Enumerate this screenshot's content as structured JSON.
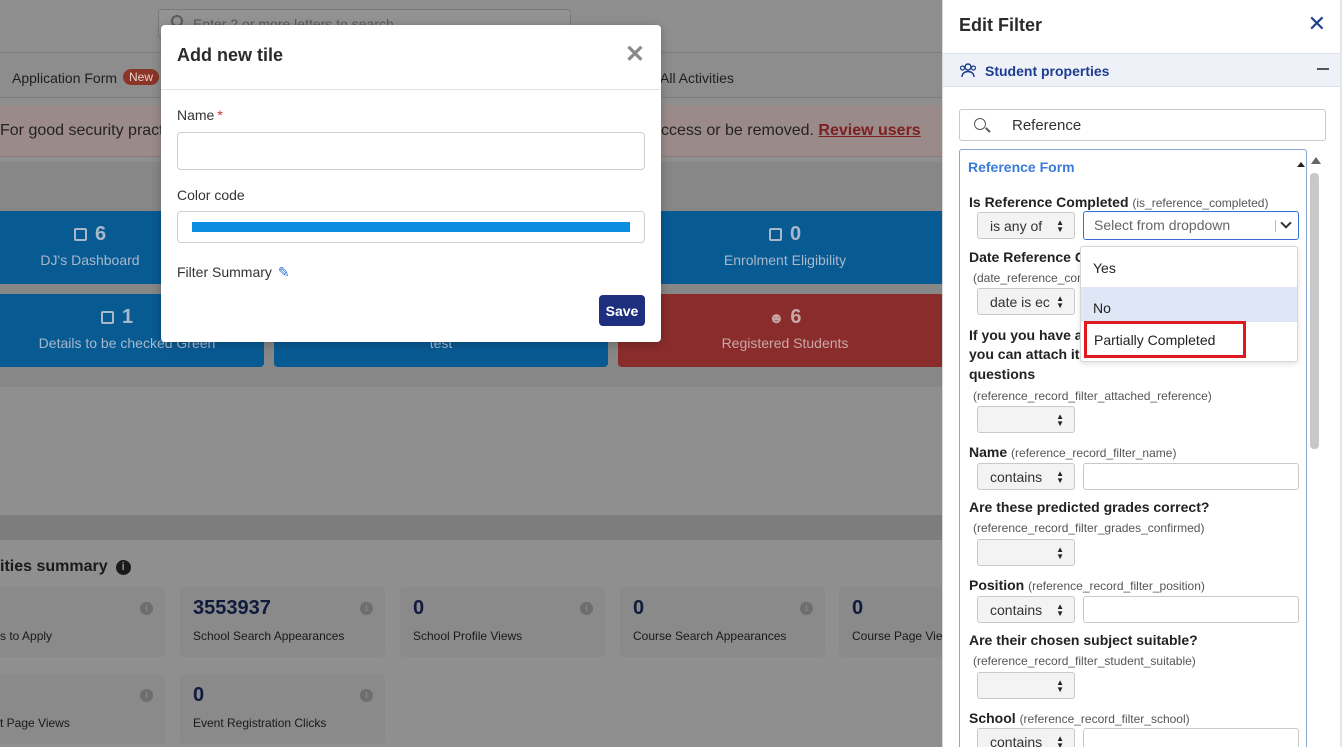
{
  "background": {
    "search_placeholder": "Enter 2 or more letters to search",
    "nav": {
      "application_form": "Application Form",
      "new_badge": "New",
      "all_activities": "All Activities"
    },
    "alert": {
      "text_left": "For good security practic",
      "text_right": "ccess or be removed.",
      "link": "Review users"
    },
    "tiles": [
      {
        "count": "6",
        "label": "DJ's Dashboard"
      },
      {
        "count": "0",
        "label": "Enrolment Eligibility"
      },
      {
        "count": "1",
        "label": "Details to be checked Green"
      },
      {
        "count": "",
        "label": "test"
      },
      {
        "count": "6",
        "label": "Registered Students"
      }
    ],
    "summary": {
      "title": "ities summary",
      "cards": [
        {
          "value": "",
          "label": "s to Apply"
        },
        {
          "value": "3553937",
          "label": "School Search Appearances"
        },
        {
          "value": "0",
          "label": "School Profile Views"
        },
        {
          "value": "0",
          "label": "Course Search Appearances"
        },
        {
          "value": "0",
          "label": "Course Page Vie"
        },
        {
          "value": "",
          "label": "t Page Views"
        },
        {
          "value": "0",
          "label": "Event Registration Clicks"
        }
      ]
    }
  },
  "modal": {
    "title": "Add new tile",
    "name_label": "Name",
    "required_mark": "*",
    "color_label": "Color code",
    "color_value": "#0a8de0",
    "filter_summary_label": "Filter Summary",
    "save_label": "Save"
  },
  "panel": {
    "title": "Edit Filter",
    "section_title": "Student properties",
    "search_value": "Reference",
    "form_title": "Reference Form",
    "questions": {
      "q1": {
        "label": "Is Reference Completed",
        "code": "(is_reference_completed)",
        "operator": "is any of",
        "dropdown_placeholder": "Select from dropdown"
      },
      "q2": {
        "label": "Date Reference C",
        "code": "(date_reference_com",
        "operator": "date is ec"
      },
      "q3": {
        "label_line1": "If you you have a",
        "label_line2": "you can attach it",
        "label_line3": "questions",
        "code": "(reference_record_filter_attached_reference)"
      },
      "q4": {
        "label": "Name",
        "code": "(reference_record_filter_name)",
        "operator": "contains"
      },
      "q5": {
        "label": "Are these predicted grades correct?",
        "code": "(reference_record_filter_grades_confirmed)"
      },
      "q6": {
        "label": "Position",
        "code": "(reference_record_filter_position)",
        "operator": "contains"
      },
      "q7": {
        "label": "Are their chosen subject suitable?",
        "code": "(reference_record_filter_student_suitable)"
      },
      "q8": {
        "label": "School",
        "code": "(reference_record_filter_school)",
        "operator": "contains"
      }
    },
    "dropdown_options": [
      "Yes",
      "No",
      "Partially Completed"
    ]
  }
}
